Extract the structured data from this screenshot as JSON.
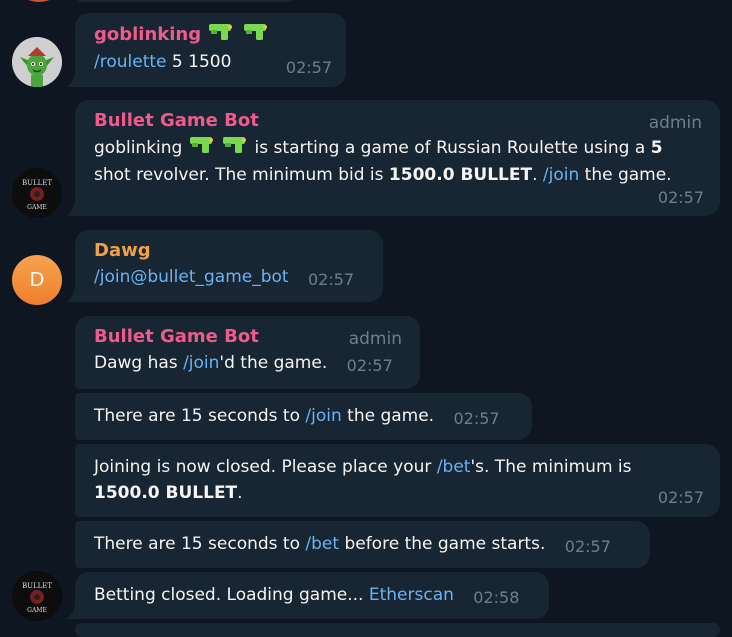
{
  "messages": {
    "m1": {
      "sender": "goblinking",
      "text_link": "/roulette",
      "text_rest": " 5 1500",
      "time": "02:57"
    },
    "m2": {
      "sender": "Bullet Game Bot",
      "badge": "admin",
      "name": "goblinking",
      "t1": " is starting a game of Russian Roulette using a ",
      "n1": "5",
      "t2": "shot revolver. The minimum bid is ",
      "n2": "1500.0 BULLET",
      "t3": ". ",
      "link": "/join",
      "t4": " the game.",
      "time": "02:57"
    },
    "m3": {
      "sender": "Dawg",
      "link": "/join@bullet_game_bot",
      "time": "02:57"
    },
    "m4": {
      "sender": "Bullet Game Bot",
      "badge": "admin",
      "t1": "Dawg has ",
      "link": "/join",
      "t2": "'d the game.",
      "time": "02:57"
    },
    "m5": {
      "t1": "There are 15 seconds to ",
      "link": "/join",
      "t2": " the game.",
      "time": "02:57"
    },
    "m6": {
      "t1": "Joining is now closed. Please place your ",
      "link": "/bet",
      "t2": "'s. The minimum is",
      "bold": "1500.0 BULLET",
      "t3": ".",
      "time": "02:57"
    },
    "m7": {
      "t1": "There are 15 seconds to ",
      "link": "/bet",
      "t2": " before the game starts.",
      "time": "02:57"
    },
    "m8": {
      "t1": "Betting closed. Loading game... ",
      "link": "Etherscan",
      "time": "02:58"
    }
  },
  "avatars": {
    "goblin": {
      "icon": "goblin-avatar"
    },
    "bot": {
      "label_top": "BULLET",
      "label_bottom": "GAME"
    },
    "dawg": {
      "letter": "D",
      "color": "#f18a35"
    }
  },
  "colors": {
    "background": "#0e1621",
    "bubble": "#182533",
    "link": "#6ab3f3",
    "pink_name": "#ee5b8d",
    "orange_name": "#f0a04b",
    "meta": "#6d7f8f"
  }
}
